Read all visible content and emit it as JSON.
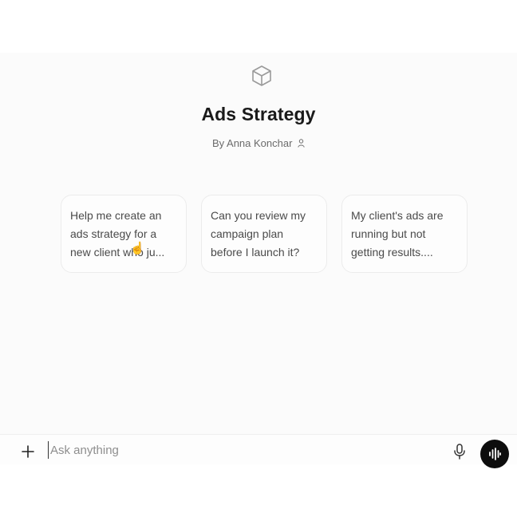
{
  "gpt": {
    "logo_icon": "cube-icon",
    "title": "Ads Strategy",
    "byline": "By Anna Konchar",
    "author_icon": "person-icon"
  },
  "starters": [
    {
      "text": "Help me create an ads strategy for a new client who ju..."
    },
    {
      "text": "Can you review my campaign plan before I launch it?"
    },
    {
      "text": "My client's ads are running but not getting results...."
    }
  ],
  "composer": {
    "placeholder": "Ask anything",
    "value": "",
    "add_icon": "plus-icon",
    "mic_icon": "microphone-icon",
    "voice_icon": "voice-waveform-icon"
  },
  "colors": {
    "voice_button_bg": "#0d0d0d",
    "title": "#1a1a1a",
    "muted_text": "#6b6b6b"
  }
}
